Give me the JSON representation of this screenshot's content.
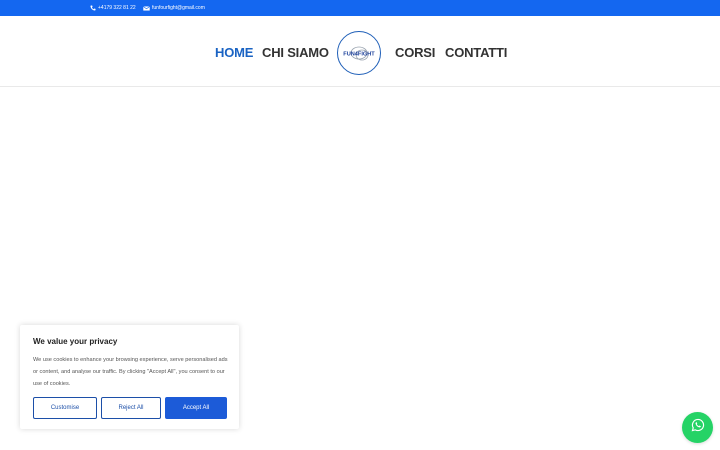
{
  "topbar": {
    "phone": "+4179 322 81 22",
    "email": "funfourfight@gmail.com",
    "bg_color": "#1467f0",
    "phone_icon": "phone-icon",
    "email_icon": "envelope-icon"
  },
  "nav": {
    "items": [
      "HOME",
      "CHI SIAMO",
      "CORSI",
      "CONTATTI"
    ],
    "active": "HOME",
    "active_color": "#1a63c3"
  },
  "logo": {
    "text": "FUN4FIGHT",
    "ring_color": "#1f5fb8"
  },
  "cookie": {
    "title": "We value your privacy",
    "text": "We use cookies to enhance your browsing experience, serve personalised ads or content, and analyse our traffic. By clicking \"Accept All\", you consent to our use of cookies.",
    "customise": "Customise",
    "reject": "Reject All",
    "accept": "Accept All",
    "button_color": "#1c5bd8"
  },
  "whatsapp": {
    "icon": "whatsapp-icon",
    "color": "#25d366"
  }
}
